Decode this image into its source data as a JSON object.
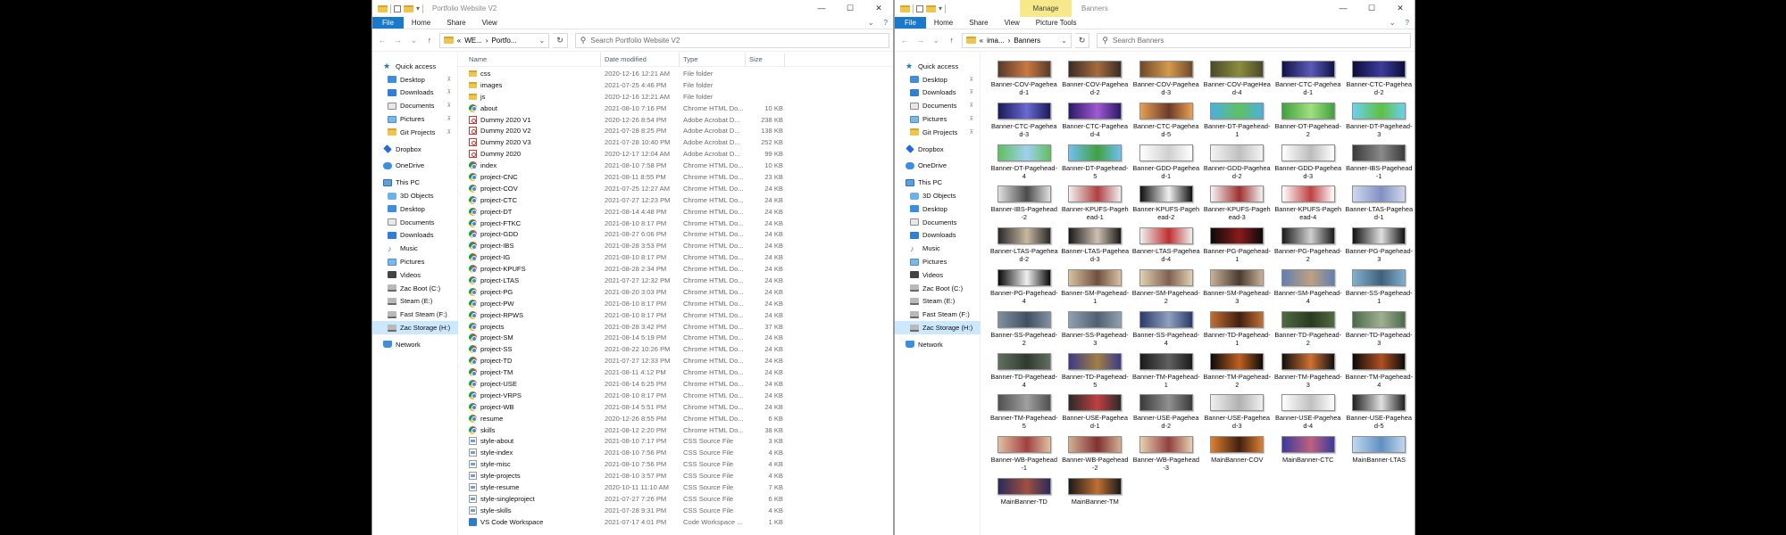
{
  "left_window": {
    "title": "Portfolio Website V2",
    "ribbon_tabs": [
      "File",
      "Home",
      "Share",
      "View"
    ],
    "address": {
      "prefix": "«",
      "crumbs": [
        "WE...",
        "Portfo..."
      ],
      "sep": "›"
    },
    "search_placeholder": "Search Portfolio Website V2",
    "columns": {
      "name": "Name",
      "date": "Date modified",
      "type": "Type",
      "size": "Size"
    },
    "files": [
      {
        "name": "css",
        "date": "2020-12-16 12:21 AM",
        "type": "File folder",
        "size": "",
        "icon": "folder"
      },
      {
        "name": "images",
        "date": "2021-07-25 4:46 PM",
        "type": "File folder",
        "size": "",
        "icon": "folder"
      },
      {
        "name": "js",
        "date": "2020-12-16 12:21 AM",
        "type": "File folder",
        "size": "",
        "icon": "folder"
      },
      {
        "name": "about",
        "date": "2021-08-10 7:16 PM",
        "type": "Chrome HTML Do...",
        "size": "10 KB",
        "icon": "chrome"
      },
      {
        "name": "Dummy 2020 V1",
        "date": "2020-12-26 8:54 PM",
        "type": "Adobe Acrobat D...",
        "size": "238 KB",
        "icon": "pdf"
      },
      {
        "name": "Dummy 2020 V2",
        "date": "2021-07-28 8:25 PM",
        "type": "Adobe Acrobat D...",
        "size": "138 KB",
        "icon": "pdf"
      },
      {
        "name": "Dummy 2020 V3",
        "date": "2021-07-28 10:40 PM",
        "type": "Adobe Acrobat D...",
        "size": "252 KB",
        "icon": "pdf"
      },
      {
        "name": "Dummy 2020",
        "date": "2020-12-17 12:04 AM",
        "type": "Adobe Acrobat D...",
        "size": "99 KB",
        "icon": "pdf"
      },
      {
        "name": "index",
        "date": "2021-08-10 7:58 PM",
        "type": "Chrome HTML Do...",
        "size": "10 KB",
        "icon": "chrome"
      },
      {
        "name": "project-CNC",
        "date": "2021-08-11 8:55 PM",
        "type": "Chrome HTML Do...",
        "size": "23 KB",
        "icon": "chrome"
      },
      {
        "name": "project-COV",
        "date": "2021-07-25 12:27 AM",
        "type": "Chrome HTML Do...",
        "size": "24 KB",
        "icon": "chrome"
      },
      {
        "name": "project-CTC",
        "date": "2021-07-27 12:23 PM",
        "type": "Chrome HTML Do...",
        "size": "24 KB",
        "icon": "chrome"
      },
      {
        "name": "project-DT",
        "date": "2021-08-14 4:48 PM",
        "type": "Chrome HTML Do...",
        "size": "24 KB",
        "icon": "chrome"
      },
      {
        "name": "project-FTKC",
        "date": "2021-08-10 8:17 PM",
        "type": "Chrome HTML Do...",
        "size": "24 KB",
        "icon": "chrome"
      },
      {
        "name": "project-GDD",
        "date": "2021-08-27 6:06 PM",
        "type": "Chrome HTML Do...",
        "size": "24 KB",
        "icon": "chrome"
      },
      {
        "name": "project-IBS",
        "date": "2021-08-28 3:53 PM",
        "type": "Chrome HTML Do...",
        "size": "24 KB",
        "icon": "chrome"
      },
      {
        "name": "project-IG",
        "date": "2021-08-10 8:17 PM",
        "type": "Chrome HTML Do...",
        "size": "24 KB",
        "icon": "chrome"
      },
      {
        "name": "project-KPUFS",
        "date": "2021-08-28 2:34 PM",
        "type": "Chrome HTML Do...",
        "size": "24 KB",
        "icon": "chrome"
      },
      {
        "name": "project-LTAS",
        "date": "2021-07-27 12:32 PM",
        "type": "Chrome HTML Do...",
        "size": "24 KB",
        "icon": "chrome"
      },
      {
        "name": "project-PG",
        "date": "2021-08-20 3:03 PM",
        "type": "Chrome HTML Do...",
        "size": "24 KB",
        "icon": "chrome"
      },
      {
        "name": "project-PW",
        "date": "2021-08-10 8:17 PM",
        "type": "Chrome HTML Do...",
        "size": "24 KB",
        "icon": "chrome"
      },
      {
        "name": "project-RPWS",
        "date": "2021-08-10 8:17 PM",
        "type": "Chrome HTML Do...",
        "size": "24 KB",
        "icon": "chrome"
      },
      {
        "name": "projects",
        "date": "2021-08-28 3:42 PM",
        "type": "Chrome HTML Do...",
        "size": "37 KB",
        "icon": "chrome"
      },
      {
        "name": "project-SM",
        "date": "2021-08-14 5:19 PM",
        "type": "Chrome HTML Do...",
        "size": "24 KB",
        "icon": "chrome"
      },
      {
        "name": "project-SS",
        "date": "2021-08-22 10:26 PM",
        "type": "Chrome HTML Do...",
        "size": "24 KB",
        "icon": "chrome"
      },
      {
        "name": "project-TD",
        "date": "2021-07-27 12:33 PM",
        "type": "Chrome HTML Do...",
        "size": "24 KB",
        "icon": "chrome"
      },
      {
        "name": "project-TM",
        "date": "2021-08-11 4:12 PM",
        "type": "Chrome HTML Do...",
        "size": "24 KB",
        "icon": "chrome"
      },
      {
        "name": "project-USE",
        "date": "2021-08-14 6:25 PM",
        "type": "Chrome HTML Do...",
        "size": "24 KB",
        "icon": "chrome"
      },
      {
        "name": "project-VRPS",
        "date": "2021-08-10 8:17 PM",
        "type": "Chrome HTML Do...",
        "size": "24 KB",
        "icon": "chrome"
      },
      {
        "name": "project-WB",
        "date": "2021-08-14 5:51 PM",
        "type": "Chrome HTML Do...",
        "size": "24 KB",
        "icon": "chrome"
      },
      {
        "name": "resume",
        "date": "2020-12-26 8:55 PM",
        "type": "Chrome HTML Do...",
        "size": "6 KB",
        "icon": "chrome"
      },
      {
        "name": "skills",
        "date": "2021-08-12 2:20 PM",
        "type": "Chrome HTML Do...",
        "size": "38 KB",
        "icon": "chrome"
      },
      {
        "name": "style-about",
        "date": "2021-08-10 7:17 PM",
        "type": "CSS Source File",
        "size": "3 KB",
        "icon": "css"
      },
      {
        "name": "style-index",
        "date": "2021-08-10 7:56 PM",
        "type": "CSS Source File",
        "size": "4 KB",
        "icon": "css"
      },
      {
        "name": "style-misc",
        "date": "2021-08-10 7:56 PM",
        "type": "CSS Source File",
        "size": "4 KB",
        "icon": "css"
      },
      {
        "name": "style-projects",
        "date": "2021-08-10 3:57 PM",
        "type": "CSS Source File",
        "size": "4 KB",
        "icon": "css"
      },
      {
        "name": "style-resume",
        "date": "2020-10-11 11:10 AM",
        "type": "CSS Source File",
        "size": "7 KB",
        "icon": "css"
      },
      {
        "name": "style-singleproject",
        "date": "2021-07-27 7:26 PM",
        "type": "CSS Source File",
        "size": "6 KB",
        "icon": "css"
      },
      {
        "name": "style-skills",
        "date": "2021-07-28 9:31 PM",
        "type": "CSS Source File",
        "size": "4 KB",
        "icon": "css"
      },
      {
        "name": "VS Code Workspace",
        "date": "2021-07-17 4:01 PM",
        "type": "Code Workspace ...",
        "size": "1 KB",
        "icon": "vscode"
      }
    ]
  },
  "right_window": {
    "title": "Banners",
    "manage_label": "Manage",
    "ribbon_tabs": [
      "File",
      "Home",
      "Share",
      "View",
      "Picture Tools"
    ],
    "address": {
      "prefix": "«",
      "crumbs": [
        "ima...",
        "Banners"
      ],
      "sep": "›"
    },
    "search_placeholder": "Search Banners",
    "tiles": [
      {
        "name": "Banner-COV-Pagehead-1",
        "colors": [
          "#5a3a2a",
          "#c87a40"
        ]
      },
      {
        "name": "Banner-COV-Pagehead-2",
        "colors": [
          "#3a2c24",
          "#a46c3c"
        ]
      },
      {
        "name": "Banner-COV-Pagehead-3",
        "colors": [
          "#6e4a2a",
          "#d59a4a"
        ]
      },
      {
        "name": "Banner-COV-PageHead-4",
        "colors": [
          "#4a4a2a",
          "#8c8c3c"
        ]
      },
      {
        "name": "Banner-CTC-Pagehead-1",
        "colors": [
          "#12124a",
          "#5a5ab8"
        ]
      },
      {
        "name": "Banner-CTC-Pagehead-2",
        "colors": [
          "#0c0c3a",
          "#3c3c9c"
        ]
      },
      {
        "name": "Banner-CTC-Pagehead-3",
        "colors": [
          "#1a1a5a",
          "#6a6ad0"
        ]
      },
      {
        "name": "Banner-CTC-Pagehead-4",
        "colors": [
          "#2a1a6a",
          "#a05ad0"
        ]
      },
      {
        "name": "Banner-CTC-Pagehead-5",
        "colors": [
          "#e8a050",
          "#6a3a2a"
        ]
      },
      {
        "name": "Banner-DT-Pagehead-1",
        "colors": [
          "#4ab0e0",
          "#60c060"
        ]
      },
      {
        "name": "Banner-DT-Pagehead-2",
        "colors": [
          "#40a040",
          "#a0e080"
        ]
      },
      {
        "name": "Banner-DT-Pagehead-3",
        "colors": [
          "#6ad0f0",
          "#60c040"
        ]
      },
      {
        "name": "Banner-DT-Pagehead-4",
        "colors": [
          "#60c060",
          "#a0d0f0"
        ]
      },
      {
        "name": "Banner-DT-Pagehead-5",
        "colors": [
          "#70c0f0",
          "#40a040"
        ]
      },
      {
        "name": "Banner-GDD-Pagehead-1",
        "colors": [
          "#ffffff",
          "#d0d0d0"
        ]
      },
      {
        "name": "Banner-GDD-Pagehead-2",
        "colors": [
          "#f4f4f4",
          "#c0c0c0"
        ]
      },
      {
        "name": "Banner-GDD-Pagehead-3",
        "colors": [
          "#ffffff",
          "#bcbcbc"
        ]
      },
      {
        "name": "Banner-IBS-Pagehead-1",
        "colors": [
          "#3a3a3a",
          "#8a8a8a"
        ]
      },
      {
        "name": "Banner-IBS-Pagehead-2",
        "colors": [
          "#e0e0e0",
          "#4a4a4a"
        ]
      },
      {
        "name": "Banner-KPUFS-Pagehead-1",
        "colors": [
          "#f0f0f0",
          "#b04040"
        ]
      },
      {
        "name": "Banner-KPUFS-Pagehead-2",
        "colors": [
          "#101010",
          "#f0f0f0"
        ]
      },
      {
        "name": "Banner-KPUFS-Pagehead-3",
        "colors": [
          "#f4f4f4",
          "#a03030"
        ]
      },
      {
        "name": "Banner-KPUFS-Pagehead-4",
        "colors": [
          "#ffffff",
          "#c04040"
        ]
      },
      {
        "name": "Banner-LTAS-Pagehead-1",
        "colors": [
          "#d0d8f0",
          "#8090c0"
        ]
      },
      {
        "name": "Banner-LTAS-Pagehead-2",
        "colors": [
          "#2a2a2a",
          "#c8b8a0"
        ]
      },
      {
        "name": "Banner-LTAS-Pagehead-3",
        "colors": [
          "#1a1a1a",
          "#d0c0b0"
        ]
      },
      {
        "name": "Banner-LTAS-Pagehead-4",
        "colors": [
          "#f0f0f0",
          "#c03030"
        ]
      },
      {
        "name": "Banner-PG-Pagehead-1",
        "colors": [
          "#0a0a0a",
          "#8a1a1a"
        ]
      },
      {
        "name": "Banner-PG-Pagehead-2",
        "colors": [
          "#1a1a1a",
          "#d0d0d0"
        ]
      },
      {
        "name": "Banner-PG-Pagehead-3",
        "colors": [
          "#101010",
          "#e0e0e0"
        ]
      },
      {
        "name": "Banner-PG-Pagehead-4",
        "colors": [
          "#0a0a0a",
          "#f0f0f0"
        ]
      },
      {
        "name": "Banner-SM-Pagehead-1",
        "colors": [
          "#d8c0a0",
          "#705040"
        ]
      },
      {
        "name": "Banner-SM-Pagehead-2",
        "colors": [
          "#e0d0b0",
          "#806050"
        ]
      },
      {
        "name": "Banner-SM-Pagehead-3",
        "colors": [
          "#c8b098",
          "#4a3a30"
        ]
      },
      {
        "name": "Banner-SM-Pagehead-4",
        "colors": [
          "#6080b0",
          "#c0a080"
        ]
      },
      {
        "name": "Banner-SS-Pagehead-1",
        "colors": [
          "#80b0d0",
          "#40607a"
        ]
      },
      {
        "name": "Banner-SS-Pagehead-2",
        "colors": [
          "#8090a0",
          "#405060"
        ]
      },
      {
        "name": "Banner-SS-Pagehead-3",
        "colors": [
          "#90a0b0",
          "#506070"
        ]
      },
      {
        "name": "Banner-SS-Pagehead-4",
        "colors": [
          "#2a3a6a",
          "#90a0c0"
        ]
      },
      {
        "name": "Banner-TD-Pagehead-1",
        "colors": [
          "#c07030",
          "#402010"
        ]
      },
      {
        "name": "Banner-TD-Pagehead-2",
        "colors": [
          "#506a40",
          "#2a3a20"
        ]
      },
      {
        "name": "Banner-TD-Pagehead-3",
        "colors": [
          "#4a6a4a",
          "#a0b090"
        ]
      },
      {
        "name": "Banner-TD-Pagehead-4",
        "colors": [
          "#607060",
          "#303a30"
        ]
      },
      {
        "name": "Banner-TD-Pagehead-5",
        "colors": [
          "#3a3a8a",
          "#a08040"
        ]
      },
      {
        "name": "Banner-TM-Pagehead-1",
        "colors": [
          "#1a1a1a",
          "#606060"
        ]
      },
      {
        "name": "Banner-TM-Pagehead-2",
        "colors": [
          "#0a0a0a",
          "#c06020"
        ]
      },
      {
        "name": "Banner-TM-Pagehead-3",
        "colors": [
          "#101010",
          "#d07030"
        ]
      },
      {
        "name": "Banner-TM-Pagehead-4",
        "colors": [
          "#0a0a0a",
          "#b05020"
        ]
      },
      {
        "name": "Banner-TM-Pagehead-5",
        "colors": [
          "#505050",
          "#a0a0a0"
        ]
      },
      {
        "name": "Banner-USE-Pagehead-1",
        "colors": [
          "#2a2a2a",
          "#c04040"
        ]
      },
      {
        "name": "Banner-USE-Pagehead-2",
        "colors": [
          "#3a3a3a",
          "#909090"
        ]
      },
      {
        "name": "Banner-USE-Pagehead-3",
        "colors": [
          "#f0f0f0",
          "#b0b0b0"
        ]
      },
      {
        "name": "Banner-USE-Pagehead-4",
        "colors": [
          "#ffffff",
          "#c0c0c0"
        ]
      },
      {
        "name": "Banner-USE-Pagehead-5",
        "colors": [
          "#202020",
          "#e0e0e0"
        ]
      },
      {
        "name": "Banner-WB-Pagehead-1",
        "colors": [
          "#e0c0a0",
          "#a04040"
        ]
      },
      {
        "name": "Banner-WB-Pagehead-2",
        "colors": [
          "#d0b090",
          "#803030"
        ]
      },
      {
        "name": "Banner-WB-Pagehead-3",
        "colors": [
          "#e8d0b0",
          "#904040"
        ]
      },
      {
        "name": "MainBanner-COV",
        "colors": [
          "#e08030",
          "#402010"
        ]
      },
      {
        "name": "MainBanner-CTC",
        "colors": [
          "#3a3a9a",
          "#c06080"
        ]
      },
      {
        "name": "MainBanner-LTAS",
        "colors": [
          "#c0d8f0",
          "#6090c0"
        ]
      },
      {
        "name": "MainBanner-TD",
        "colors": [
          "#2a2a5a",
          "#a05040"
        ]
      },
      {
        "name": "MainBanner-TM",
        "colors": [
          "#1a1a1a",
          "#c07030"
        ]
      }
    ]
  },
  "nav_pane": {
    "items": [
      {
        "label": "Quick access",
        "icon": "star-icon",
        "cls": "star",
        "lvl": 0,
        "pin": false
      },
      {
        "label": "Desktop",
        "icon": "desktop-icon",
        "cls": "blue",
        "lvl": 1,
        "pin": true
      },
      {
        "label": "Downloads",
        "icon": "downloads-icon",
        "cls": "dl",
        "lvl": 1,
        "pin": true
      },
      {
        "label": "Documents",
        "icon": "documents-icon",
        "cls": "doc",
        "lvl": 1,
        "pin": true
      },
      {
        "label": "Pictures",
        "icon": "pictures-icon",
        "cls": "pic",
        "lvl": 1,
        "pin": true
      },
      {
        "label": "Git Projects",
        "icon": "folder-icon",
        "cls": "yellow",
        "lvl": 1,
        "pin": true
      },
      {
        "label": "Dropbox",
        "icon": "dropbox-icon",
        "cls": "drop",
        "lvl": 0,
        "pin": false,
        "gap": true
      },
      {
        "label": "OneDrive",
        "icon": "onedrive-icon",
        "cls": "cloud",
        "lvl": 0,
        "pin": false,
        "gap": true
      },
      {
        "label": "This PC",
        "icon": "computer-icon",
        "cls": "pc",
        "lvl": 0,
        "pin": false,
        "gap": true
      },
      {
        "label": "3D Objects",
        "icon": "3d-objects-icon",
        "cls": "obj",
        "lvl": 1,
        "pin": false
      },
      {
        "label": "Desktop",
        "icon": "desktop-icon",
        "cls": "blue",
        "lvl": 1,
        "pin": false
      },
      {
        "label": "Documents",
        "icon": "documents-icon",
        "cls": "doc",
        "lvl": 1,
        "pin": false
      },
      {
        "label": "Downloads",
        "icon": "downloads-icon",
        "cls": "dl",
        "lvl": 1,
        "pin": false
      },
      {
        "label": "Music",
        "icon": "music-icon",
        "cls": "music",
        "lvl": 1,
        "pin": false
      },
      {
        "label": "Pictures",
        "icon": "pictures-icon",
        "cls": "pic",
        "lvl": 1,
        "pin": false
      },
      {
        "label": "Videos",
        "icon": "videos-icon",
        "cls": "video",
        "lvl": 1,
        "pin": false
      },
      {
        "label": "Zac Boot (C:)",
        "icon": "drive-icon",
        "cls": "drive",
        "lvl": 1,
        "pin": false
      },
      {
        "label": "Steam (E:)",
        "icon": "drive-icon",
        "cls": "drive",
        "lvl": 1,
        "pin": false
      },
      {
        "label": "Fast Steam (F:)",
        "icon": "drive-icon",
        "cls": "drive",
        "lvl": 1,
        "pin": false
      },
      {
        "label": "Zac Storage (H:)",
        "icon": "drive-icon",
        "cls": "drive",
        "lvl": 1,
        "pin": false,
        "sel": true
      },
      {
        "label": "Network",
        "icon": "network-icon",
        "cls": "net",
        "lvl": 0,
        "pin": false,
        "gap": true
      }
    ]
  },
  "controls": {
    "minimize": "—",
    "maximize": "☐",
    "close": "✕"
  }
}
